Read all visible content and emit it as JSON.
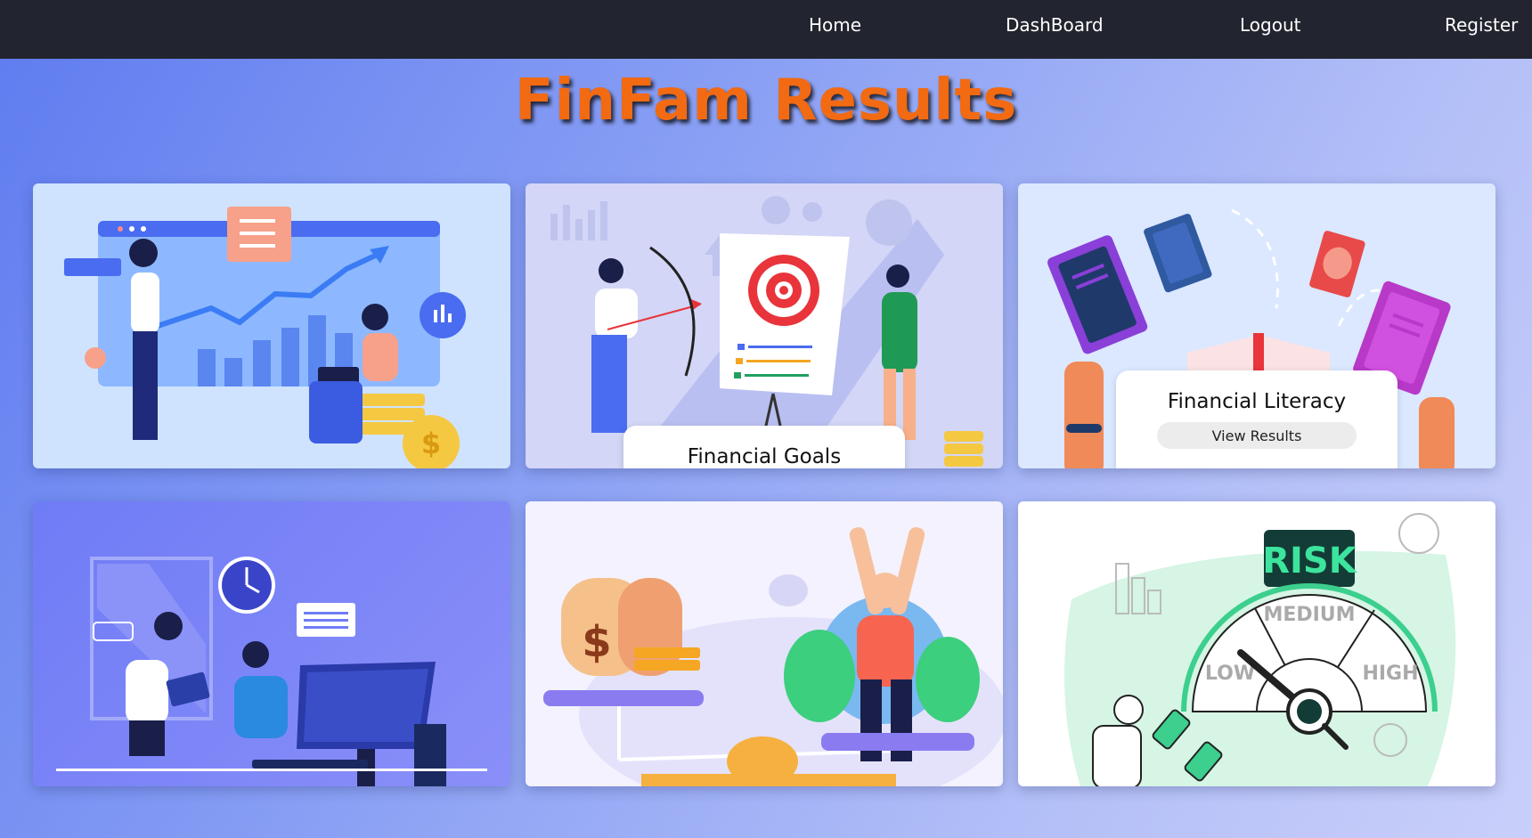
{
  "nav": {
    "home": "Home",
    "dashboard": "DashBoard",
    "logout": "Logout",
    "register": "Register"
  },
  "page": {
    "title": "FinFam Results"
  },
  "cards": [
    {
      "title": "",
      "art": "growth-chart-illustration"
    },
    {
      "title": "Financial Goals",
      "art": "target-goals-illustration"
    },
    {
      "title": "Financial Literacy",
      "button": "View Results",
      "art": "books-illustration"
    },
    {
      "title": "",
      "art": "office-work-illustration"
    },
    {
      "title": "",
      "art": "savings-balance-illustration"
    },
    {
      "title": "",
      "art": "risk-gauge-illustration"
    }
  ],
  "risk_gauge": {
    "header": "RISK",
    "low": "LOW",
    "medium": "MEDIUM",
    "high": "HIGH"
  },
  "colors": {
    "navbar": "#22252f",
    "title": "#f26a12",
    "accent_blue": "#4b6cf0",
    "risk_green": "#3ccf8e"
  }
}
